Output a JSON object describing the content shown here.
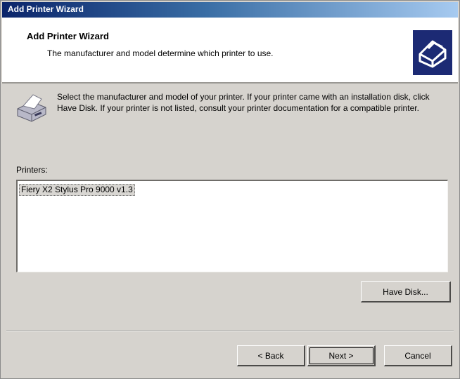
{
  "window": {
    "title": "Add Printer Wizard"
  },
  "header": {
    "title": "Add Printer Wizard",
    "subtitle": "The manufacturer and model determine which printer to use.",
    "icon": "wizard-printer-icon"
  },
  "body": {
    "icon": "printer-icon",
    "description": "Select the manufacturer and model of your printer. If your printer came with an installation disk, click Have Disk. If your printer is not listed, consult your printer documentation for a compatible printer.",
    "printers_label": "Printers:",
    "printers": [
      {
        "name": "Fiery X2 Stylus Pro 9000 v1.3",
        "selected": true
      }
    ]
  },
  "buttons": {
    "have_disk": "Have Disk...",
    "back": "< Back",
    "next": "Next >",
    "cancel": "Cancel"
  },
  "colors": {
    "title_bar_start": "#0a246a",
    "title_bar_end": "#a6caf0",
    "dialog_face": "#d6d3ce",
    "header_icon_bg": "#1c2a74"
  }
}
